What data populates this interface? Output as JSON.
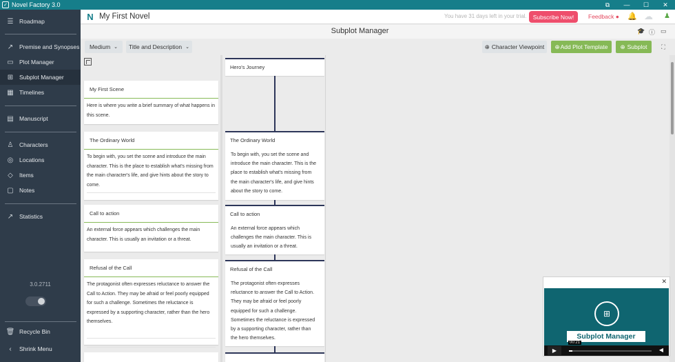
{
  "titlebar": {
    "app_name": "Novel Factory 3.0",
    "controls": {
      "restore": "⧉",
      "minimize": "—",
      "maximize": "☐",
      "close": "✕"
    }
  },
  "sidebar": {
    "items": [
      {
        "label": "Roadmap",
        "icon": "roadmap-icon",
        "glyph": "☰"
      },
      {
        "label": "Premise and Synopses",
        "icon": "chart-icon",
        "glyph": "📈"
      },
      {
        "label": "Plot Manager",
        "icon": "layout-icon",
        "glyph": "▭"
      },
      {
        "label": "Subplot Manager",
        "icon": "sitemap-icon",
        "glyph": "⊞"
      },
      {
        "label": "Timelines",
        "icon": "calendar-icon",
        "glyph": "▦"
      },
      {
        "label": "Manuscript",
        "icon": "document-icon",
        "glyph": "▤"
      },
      {
        "label": "Characters",
        "icon": "person-icon",
        "glyph": "♙"
      },
      {
        "label": "Locations",
        "icon": "location-icon",
        "glyph": "◎"
      },
      {
        "label": "Items",
        "icon": "diamond-icon",
        "glyph": "◇"
      },
      {
        "label": "Notes",
        "icon": "note-icon",
        "glyph": "▢"
      },
      {
        "label": "Statistics",
        "icon": "statistics-icon",
        "glyph": "↗"
      }
    ],
    "active_item": "Subplot Manager",
    "version": "3.0.2711",
    "recycle_bin": "Recycle Bin",
    "shrink_menu": "Shrink Menu"
  },
  "header": {
    "project_title": "My First Novel",
    "trial_text": "You have 31 days left in your trial.",
    "subscribe_label": "Subscribe Now!",
    "feedback_label": "Feedback"
  },
  "page": {
    "title": "Subplot Manager"
  },
  "toolbar": {
    "size_select": "Medium",
    "display_select": "Title and Description",
    "character_viewpoint": "Character Viewpoint",
    "add_plot_template": "Add Plot Template",
    "add_subplot": "Subplot"
  },
  "scenes": [
    {
      "title": "My First Scene",
      "description": "Here is where you write a brief summary of what happens in this scene."
    },
    {
      "title": "The Ordinary World",
      "description": "To begin with, you set the scene and introduce the main character. This is the place to establish what's missing from the main character's life, and give hints about the story to come."
    },
    {
      "title": "Call to action",
      "description": "An external force appears which challenges the main character. This is usually an invitation or a threat."
    },
    {
      "title": "Refusal of the Call",
      "description": "The protagonist often expresses reluctance to answer the Call to Action. They may be afraid or feel poorly equipped for such a challenge. Sometimes the reluctance is expressed by a supporting character, rather than the hero themselves."
    }
  ],
  "plot": {
    "header": "Hero's Journey",
    "cards": [
      {
        "title": "The Ordinary World",
        "description": "To begin with, you set the scene and introduce the main character. This is the place to establish what's missing from the main character's life, and give hints about the story to come."
      },
      {
        "title": "Call to action",
        "description": "An external force appears which challenges the main character. This is usually an invitation or a threat."
      },
      {
        "title": "Refusal of the Call",
        "description": "The protagonist often expresses reluctance to answer the Call to Action. They may be afraid or feel poorly equipped for such a challenge. Sometimes the reluctance is expressed by a supporting character, rather than the hero themselves."
      }
    ]
  },
  "video": {
    "title": "Subplot Manager",
    "time": "00:21",
    "progress": 0.04
  },
  "colors": {
    "accent": "#167e8a",
    "sidebar_bg": "#2f3c4a",
    "green": "#86b956",
    "subscribe": "#ee4e6c",
    "plot_line": "#2c3558"
  }
}
